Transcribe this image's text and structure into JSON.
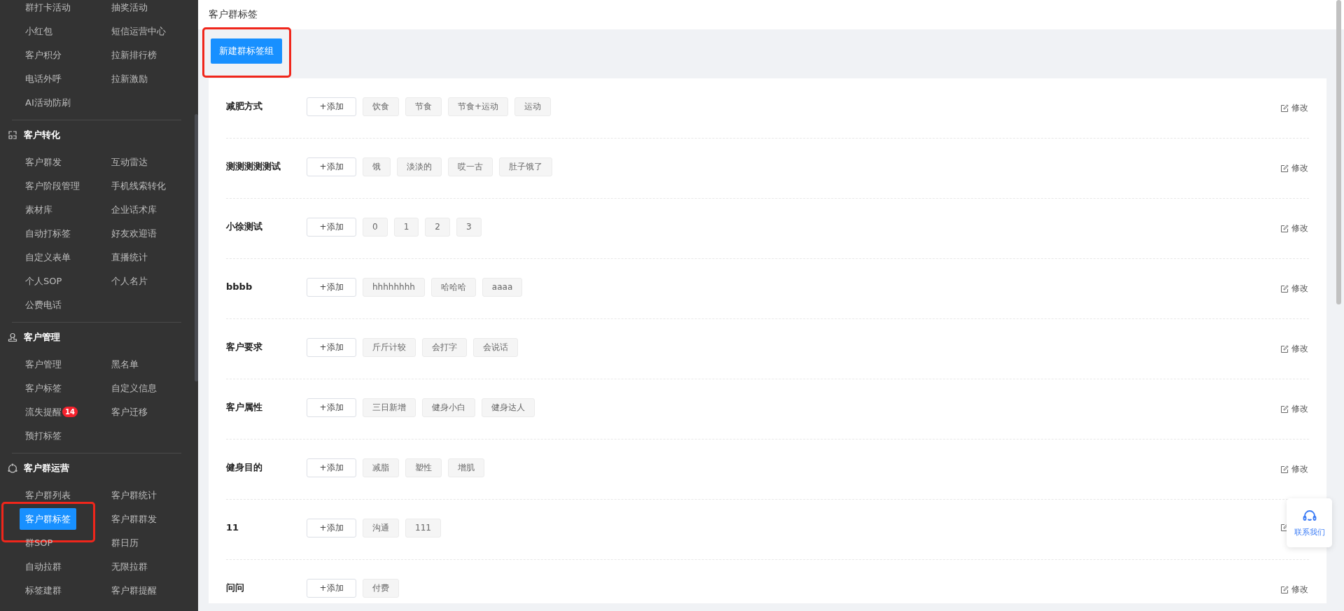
{
  "sidebar": {
    "sections": [
      {
        "items": [
          {
            "label": "群打卡活动",
            "selected": false
          },
          {
            "label": "抽奖活动",
            "selected": false
          },
          {
            "label": "小红包",
            "selected": false
          },
          {
            "label": "短信运营中心",
            "selected": false
          },
          {
            "label": "客户积分",
            "selected": false
          },
          {
            "label": "拉新排行榜",
            "selected": false
          },
          {
            "label": "电话外呼",
            "selected": false
          },
          {
            "label": "拉新激励",
            "selected": false
          },
          {
            "label": "AI活动防刷",
            "selected": false
          }
        ]
      },
      {
        "title": "客户转化",
        "items": [
          {
            "label": "客户群发",
            "selected": false
          },
          {
            "label": "互动雷达",
            "selected": false
          },
          {
            "label": "客户阶段管理",
            "selected": false
          },
          {
            "label": "手机线索转化",
            "selected": false
          },
          {
            "label": "素材库",
            "selected": false
          },
          {
            "label": "企业话术库",
            "selected": false
          },
          {
            "label": "自动打标签",
            "selected": false
          },
          {
            "label": "好友欢迎语",
            "selected": false
          },
          {
            "label": "自定义表单",
            "selected": false
          },
          {
            "label": "直播统计",
            "selected": false
          },
          {
            "label": "个人SOP",
            "selected": false
          },
          {
            "label": "个人名片",
            "selected": false
          },
          {
            "label": "公费电话",
            "selected": false
          }
        ]
      },
      {
        "title": "客户管理",
        "items": [
          {
            "label": "客户管理",
            "selected": false
          },
          {
            "label": "黑名单",
            "selected": false
          },
          {
            "label": "客户标签",
            "selected": false
          },
          {
            "label": "自定义信息",
            "selected": false
          },
          {
            "label": "流失提醒",
            "selected": false,
            "badge": "14"
          },
          {
            "label": "客户迁移",
            "selected": false
          },
          {
            "label": "预打标签",
            "selected": false
          }
        ]
      },
      {
        "title": "客户群运营",
        "items": [
          {
            "label": "客户群列表",
            "selected": false
          },
          {
            "label": "客户群统计",
            "selected": false
          },
          {
            "label": "客户群标签",
            "selected": true
          },
          {
            "label": "客户群群发",
            "selected": false
          },
          {
            "label": "群SOP",
            "selected": false
          },
          {
            "label": "群日历",
            "selected": false
          },
          {
            "label": "自动拉群",
            "selected": false
          },
          {
            "label": "无限拉群",
            "selected": false
          },
          {
            "label": "标签建群",
            "selected": false
          },
          {
            "label": "客户群提醒",
            "selected": false
          }
        ]
      }
    ]
  },
  "page_title": "客户群标签",
  "new_button": "新建群标签组",
  "groups": [
    {
      "name": "减肥方式",
      "add": "+添加",
      "tags": [
        "饮食",
        "节食",
        "节食+运动",
        "运动"
      ],
      "edit": "修改"
    },
    {
      "name": "测测测测测试",
      "add": "+添加",
      "tags": [
        "饿",
        "淡淡的",
        "哎一古",
        "肚子饿了"
      ],
      "edit": "修改"
    },
    {
      "name": "小徐测试",
      "add": "+添加",
      "tags": [
        "0",
        "1",
        "2",
        "3"
      ],
      "edit": "修改"
    },
    {
      "name": "bbbb",
      "add": "+添加",
      "tags": [
        "hhhhhhhh",
        "哈哈哈",
        "aaaa"
      ],
      "edit": "修改"
    },
    {
      "name": "客户要求",
      "add": "+添加",
      "tags": [
        "斤斤计较",
        "会打字",
        "会说话"
      ],
      "edit": "修改"
    },
    {
      "name": "客户属性",
      "add": "+添加",
      "tags": [
        "三日新增",
        "健身小白",
        "健身达人"
      ],
      "edit": "修改"
    },
    {
      "name": "健身目的",
      "add": "+添加",
      "tags": [
        "减脂",
        "塑性",
        "增肌"
      ],
      "edit": "修改"
    },
    {
      "name": "11",
      "add": "+添加",
      "tags": [
        "沟通",
        "111"
      ]
    },
    {
      "name": "问问",
      "add": "+添加",
      "tags": [
        "付费"
      ],
      "edit": "修改"
    }
  ],
  "contact": {
    "label": "联系我们"
  }
}
